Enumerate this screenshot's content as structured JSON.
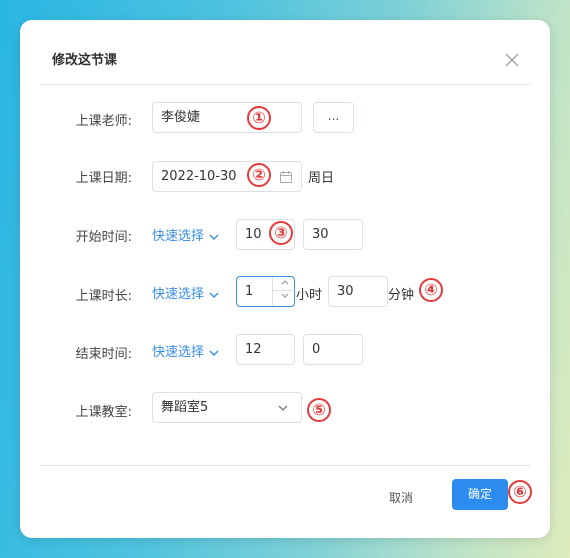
{
  "dialog": {
    "title": "修改这节课",
    "close_icon": "close-icon"
  },
  "form": {
    "teacher": {
      "label": "上课老师:",
      "value": "李俊婕",
      "more_label": "..."
    },
    "date": {
      "label": "上课日期:",
      "value": "2022-10-30",
      "weekday": "周日",
      "icon": "calendar-icon"
    },
    "start_time": {
      "label": "开始时间:",
      "quick": "快速选择",
      "hour": "10",
      "minute": "30"
    },
    "duration": {
      "label": "上课时长:",
      "quick": "快速选择",
      "hours": "1",
      "hours_unit": "小时",
      "minutes": "30",
      "minutes_unit": "分钟"
    },
    "end_time": {
      "label": "结束时间:",
      "quick": "快速选择",
      "hour": "12",
      "minute": "0"
    },
    "classroom": {
      "label": "上课教室:",
      "value": "舞蹈室5"
    }
  },
  "footer": {
    "cancel_label": "取消",
    "ok_label": "确定"
  },
  "annotations": [
    "①",
    "②",
    "③",
    "④",
    "⑤",
    "⑥"
  ],
  "colors": {
    "primary": "#2d8cf0",
    "link": "#3a8ee6",
    "marker": "#e53a3a"
  }
}
